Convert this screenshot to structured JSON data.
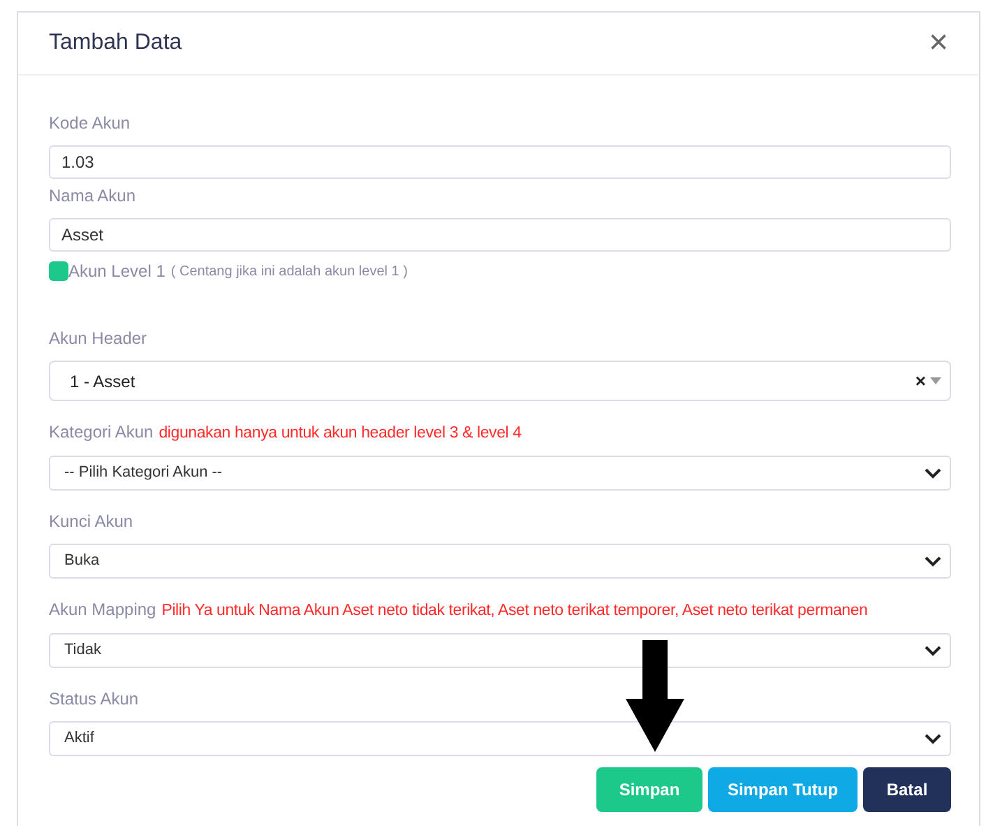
{
  "dialog": {
    "title": "Tambah Data",
    "close": "×"
  },
  "fields": [
    {
      "kind": "input",
      "label": "Kode Akun",
      "value": "1.03"
    },
    {
      "kind": "input",
      "label": "Nama Akun",
      "value": "Asset"
    },
    {
      "kind": "checkbox",
      "label": "Akun Level 1",
      "hint": "( Centang jika ini adalah akun level 1 )",
      "checked": true
    },
    {
      "kind": "combo",
      "label": "Akun Header",
      "value": "1 - Asset",
      "clear": "×"
    },
    {
      "kind": "select",
      "label": "Kategori Akun",
      "note": "digunakan hanya untuk akun header level 3 & level 4",
      "value": "-- Pilih Kategori Akun --"
    },
    {
      "kind": "select",
      "label": "Kunci Akun",
      "value": "Buka"
    },
    {
      "kind": "select",
      "label": "Akun Mapping",
      "note": "Pilih Ya untuk Nama Akun Aset neto tidak terikat, Aset neto terikat temporer, Aset neto terikat permanen",
      "value": "Tidak"
    },
    {
      "kind": "select",
      "label": "Status Akun",
      "value": "Aktif"
    }
  ],
  "buttons": [
    {
      "label": "Simpan",
      "kind": "save"
    },
    {
      "label": "Simpan Tutup",
      "kind": "save-close"
    },
    {
      "label": "Batal",
      "kind": "cancel"
    }
  ]
}
